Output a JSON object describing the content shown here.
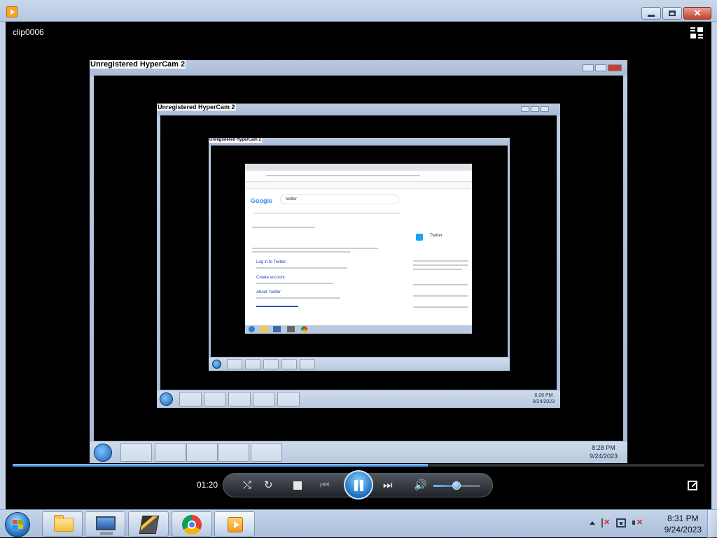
{
  "window": {
    "title_bar_text": "",
    "minimize": "minimize",
    "maximize": "maximize",
    "close": "close"
  },
  "player": {
    "clip_title": "clip0006",
    "elapsed_time": "01:20",
    "progress_fraction": 0.6,
    "volume_fraction": 0.5,
    "state": "playing"
  },
  "video": {
    "level1": {
      "window_title": "Unregistered HyperCam 2",
      "clock_time": "8:28 PM",
      "clock_date": "9/24/2023"
    },
    "level2": {
      "window_title": "Unregistered HyperCam 2",
      "clock_time": "8:26 PM",
      "clock_date": "9/24/2023"
    },
    "level3": {
      "window_title": "Unregistered HyperCam 2"
    },
    "browser": {
      "logo": "Google",
      "query": "twitter",
      "results": [
        "Log in to Twitter",
        "Create account",
        "About Twitter"
      ],
      "panel_title": "Twitter"
    }
  },
  "taskbar": {
    "start": "start",
    "apps": [
      "explorer",
      "remote-desktop",
      "hypercam",
      "chrome",
      "media-player"
    ],
    "clock_time": "8:31 PM",
    "clock_date": "9/24/2023"
  },
  "colors": {
    "seek_fill": "#3f86d8",
    "desktop_bg": "#000000",
    "chrome_bar": "#b6c8e2"
  }
}
